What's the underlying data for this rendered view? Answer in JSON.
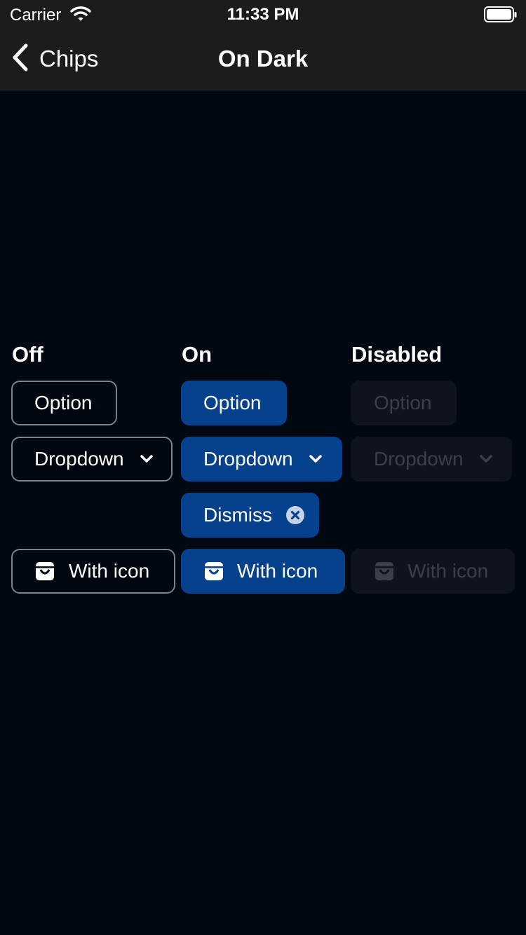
{
  "status_bar": {
    "carrier": "Carrier",
    "time": "11:33 PM",
    "wifi_icon": "wifi-icon",
    "battery_icon": "battery-icon"
  },
  "nav": {
    "back_label": "Chips",
    "title": "On Dark",
    "back_icon": "chevron-left-icon"
  },
  "columns": {
    "off": "Off",
    "on": "On",
    "disabled": "Disabled"
  },
  "chips": {
    "off": {
      "option": "Option",
      "dropdown": "Dropdown",
      "with_icon": "With icon"
    },
    "on": {
      "option": "Option",
      "dropdown": "Dropdown",
      "dismiss": "Dismiss",
      "with_icon": "With icon"
    },
    "disabled": {
      "option": "Option",
      "dropdown": "Dropdown",
      "with_icon": "With icon"
    }
  },
  "icons": {
    "dropdown": "chevron-down-icon",
    "dismiss": "close-circle-icon",
    "with_icon": "archive-icon"
  },
  "colors": {
    "background": "#020812",
    "bar": "#1b1c1e",
    "on_chip": "#06418d",
    "off_border": "#7d818a",
    "disabled_chip": "#0f141c",
    "disabled_text": "#3a3f48"
  }
}
